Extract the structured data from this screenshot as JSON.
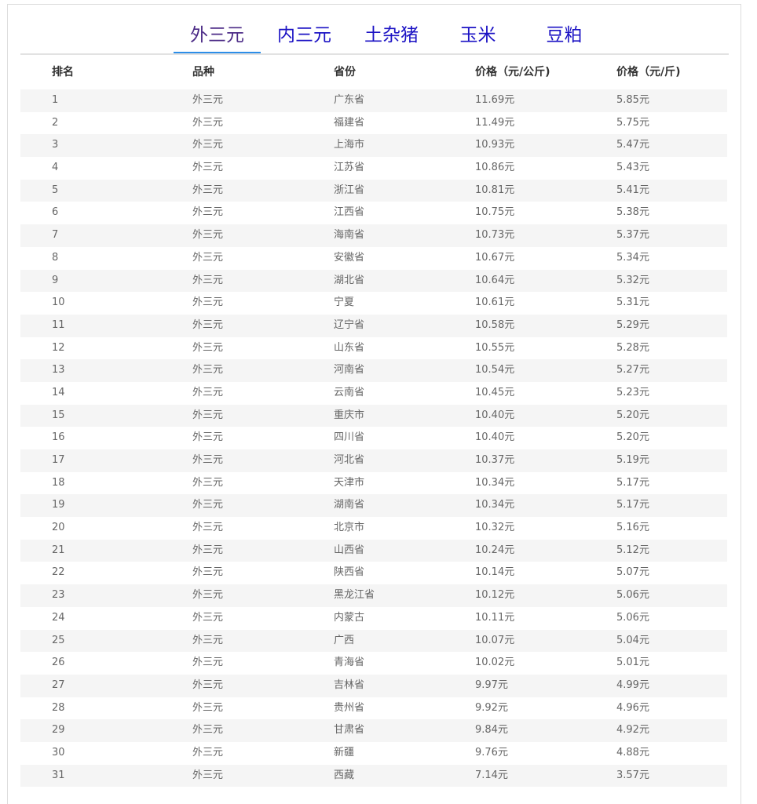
{
  "tabs": [
    {
      "label": "外三元",
      "active": true
    },
    {
      "label": "内三元",
      "active": false
    },
    {
      "label": "土杂猪",
      "active": false
    },
    {
      "label": "玉米",
      "active": false
    },
    {
      "label": "豆粕",
      "active": false
    }
  ],
  "table": {
    "headers": [
      "排名",
      "品种",
      "省份",
      "价格（元/公斤)",
      "价格（元/斤)"
    ],
    "rows": [
      [
        "1",
        "外三元",
        "广东省",
        "11.69元",
        "5.85元"
      ],
      [
        "2",
        "外三元",
        "福建省",
        "11.49元",
        "5.75元"
      ],
      [
        "3",
        "外三元",
        "上海市",
        "10.93元",
        "5.47元"
      ],
      [
        "4",
        "外三元",
        "江苏省",
        "10.86元",
        "5.43元"
      ],
      [
        "5",
        "外三元",
        "浙江省",
        "10.81元",
        "5.41元"
      ],
      [
        "6",
        "外三元",
        "江西省",
        "10.75元",
        "5.38元"
      ],
      [
        "7",
        "外三元",
        "海南省",
        "10.73元",
        "5.37元"
      ],
      [
        "8",
        "外三元",
        "安徽省",
        "10.67元",
        "5.34元"
      ],
      [
        "9",
        "外三元",
        "湖北省",
        "10.64元",
        "5.32元"
      ],
      [
        "10",
        "外三元",
        "宁夏",
        "10.61元",
        "5.31元"
      ],
      [
        "11",
        "外三元",
        "辽宁省",
        "10.58元",
        "5.29元"
      ],
      [
        "12",
        "外三元",
        "山东省",
        "10.55元",
        "5.28元"
      ],
      [
        "13",
        "外三元",
        "河南省",
        "10.54元",
        "5.27元"
      ],
      [
        "14",
        "外三元",
        "云南省",
        "10.45元",
        "5.23元"
      ],
      [
        "15",
        "外三元",
        "重庆市",
        "10.40元",
        "5.20元"
      ],
      [
        "16",
        "外三元",
        "四川省",
        "10.40元",
        "5.20元"
      ],
      [
        "17",
        "外三元",
        "河北省",
        "10.37元",
        "5.19元"
      ],
      [
        "18",
        "外三元",
        "天津市",
        "10.34元",
        "5.17元"
      ],
      [
        "19",
        "外三元",
        "湖南省",
        "10.34元",
        "5.17元"
      ],
      [
        "20",
        "外三元",
        "北京市",
        "10.32元",
        "5.16元"
      ],
      [
        "21",
        "外三元",
        "山西省",
        "10.24元",
        "5.12元"
      ],
      [
        "22",
        "外三元",
        "陕西省",
        "10.14元",
        "5.07元"
      ],
      [
        "23",
        "外三元",
        "黑龙江省",
        "10.12元",
        "5.06元"
      ],
      [
        "24",
        "外三元",
        "内蒙古",
        "10.11元",
        "5.06元"
      ],
      [
        "25",
        "外三元",
        "广西",
        "10.07元",
        "5.04元"
      ],
      [
        "26",
        "外三元",
        "青海省",
        "10.02元",
        "5.01元"
      ],
      [
        "27",
        "外三元",
        "吉林省",
        "9.97元",
        "4.99元"
      ],
      [
        "28",
        "外三元",
        "贵州省",
        "9.92元",
        "4.96元"
      ],
      [
        "29",
        "外三元",
        "甘肃省",
        "9.84元",
        "4.92元"
      ],
      [
        "30",
        "外三元",
        "新疆",
        "9.76元",
        "4.88元"
      ],
      [
        "31",
        "外三元",
        "西藏",
        "7.14元",
        "3.57元"
      ]
    ]
  }
}
